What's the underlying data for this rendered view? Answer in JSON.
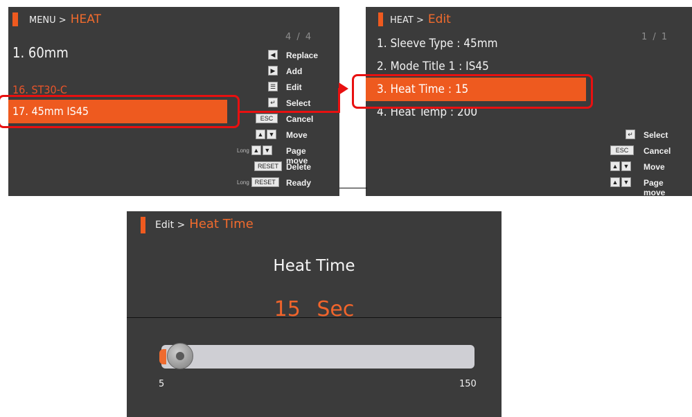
{
  "panel1": {
    "breadcrumb": {
      "parent": "MENU >",
      "current": "HEAT"
    },
    "page_indicator": "4 / 4",
    "items": [
      {
        "label": "1. 60mm"
      },
      {
        "label": "16. ST30-C"
      },
      {
        "label": "17. 45mm IS45",
        "selected": true
      }
    ],
    "keys": [
      {
        "icon": "left-arrow-icon",
        "label": "Replace"
      },
      {
        "icon": "right-arrow-icon",
        "label": "Add"
      },
      {
        "icon": "edit-icon",
        "label": "Edit"
      },
      {
        "icon": "enter-icon",
        "label": "Select"
      },
      {
        "icon": "ESC",
        "label": "Cancel"
      },
      {
        "icon": "up-down-arrows-icon",
        "label": "Move"
      },
      {
        "prefix": "Long",
        "icon": "up-down-arrows-icon",
        "label": "Page move"
      },
      {
        "icon": "RESET",
        "label": "Delete"
      },
      {
        "prefix": "Long",
        "icon": "RESET",
        "label": "Ready"
      }
    ]
  },
  "panel2": {
    "breadcrumb": {
      "parent": "HEAT >",
      "current": "Edit"
    },
    "page_indicator": "1 / 1",
    "items": [
      {
        "label": "1. Sleeve Type : 45mm"
      },
      {
        "label": "2. Mode Title 1 : IS45"
      },
      {
        "label": "3. Heat Time : 15",
        "selected": true
      },
      {
        "label": "4. Heat Temp : 200"
      }
    ],
    "keys": [
      {
        "icon": "enter-icon",
        "label": "Select"
      },
      {
        "icon": "ESC",
        "label": "Cancel"
      },
      {
        "icon": "up-down-arrows-icon",
        "label": "Move"
      },
      {
        "icon": "up-down-arrows-icon",
        "label": "Page move"
      }
    ]
  },
  "panel3": {
    "breadcrumb": {
      "parent": "Edit >",
      "current": "Heat Time"
    },
    "title": "Heat Time",
    "value": "15",
    "unit": "Sec",
    "slider": {
      "min": "5",
      "max": "150",
      "current": 15
    }
  },
  "colors": {
    "screen_bg": "#3b3b3b",
    "accent": "#ee5a1f",
    "highlight_red": "#e81010"
  }
}
